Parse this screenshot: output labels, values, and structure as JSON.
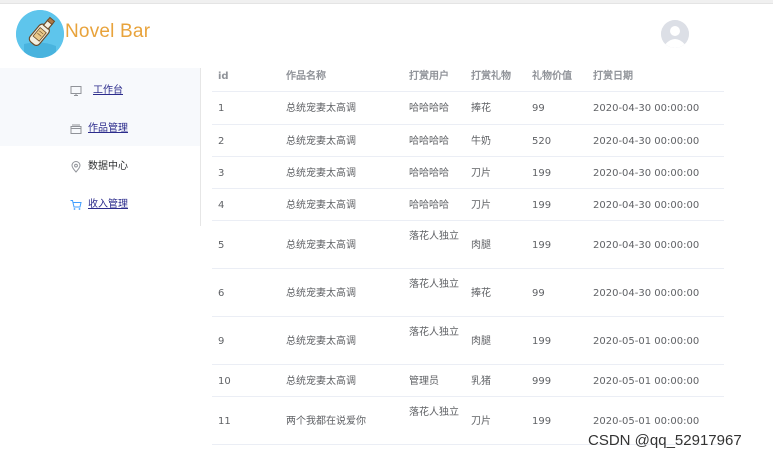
{
  "header": {
    "brand": "Novel Bar",
    "logo_icon": "bottle-logo-icon",
    "avatar_icon": "user-avatar-icon",
    "brand_color": "#e8a33c",
    "logo_bg": "#5ec5ec"
  },
  "sidebar": {
    "items": [
      {
        "label": "工作台",
        "icon": "monitor-icon"
      },
      {
        "label": "作品管理",
        "icon": "folder-icon"
      },
      {
        "label": "数据中心",
        "icon": "location-icon"
      },
      {
        "label": "收入管理",
        "icon": "cart-icon"
      }
    ]
  },
  "table": {
    "columns": [
      "id",
      "作品名称",
      "打赏用户",
      "打赏礼物",
      "礼物价值",
      "打赏日期"
    ],
    "rows": [
      [
        "1",
        "总统宠妻太高调",
        "哈哈哈哈",
        "捧花",
        "99",
        "2020-04-30 00:00:00"
      ],
      [
        "2",
        "总统宠妻太高调",
        "哈哈哈哈",
        "牛奶",
        "520",
        "2020-04-30 00:00:00"
      ],
      [
        "3",
        "总统宠妻太高调",
        "哈哈哈哈",
        "刀片",
        "199",
        "2020-04-30 00:00:00"
      ],
      [
        "4",
        "总统宠妻太高调",
        "哈哈哈哈",
        "刀片",
        "199",
        "2020-04-30 00:00:00"
      ],
      [
        "5",
        "总统宠妻太高调",
        "落花人独立",
        "肉腿",
        "199",
        "2020-04-30 00:00:00"
      ],
      [
        "6",
        "总统宠妻太高调",
        "落花人独立",
        "捧花",
        "99",
        "2020-04-30 00:00:00"
      ],
      [
        "9",
        "总统宠妻太高调",
        "落花人独立",
        "肉腿",
        "199",
        "2020-05-01 00:00:00"
      ],
      [
        "10",
        "总统宠妻太高调",
        "管理员",
        "乳猪",
        "999",
        "2020-05-01 00:00:00"
      ],
      [
        "11",
        "两个我都在说爱你",
        "落花人独立",
        "刀片",
        "199",
        "2020-05-01 00:00:00"
      ]
    ]
  },
  "watermark": "CSDN @qq_52917967"
}
